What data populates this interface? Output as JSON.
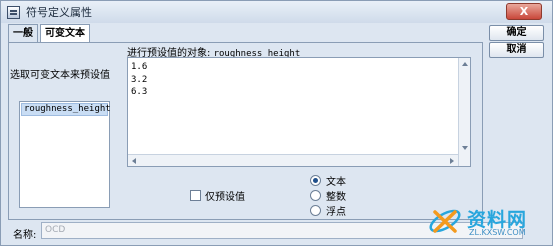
{
  "window": {
    "title": "符号定义属性",
    "close_label": "X"
  },
  "tabs": [
    {
      "label": "一般"
    },
    {
      "label": "可变文本",
      "active": true
    }
  ],
  "left": {
    "label": "选取可变文本来预设值",
    "items": [
      "roughness_height"
    ]
  },
  "right": {
    "target_prefix": "进行预设值的对象:",
    "target_name": "roughness_height",
    "values": [
      "1.6",
      "3.2",
      "6.3"
    ],
    "preset_only_label": "仅预设值",
    "types": [
      {
        "label": "文本",
        "selected": true
      },
      {
        "label": "整数",
        "selected": false
      },
      {
        "label": "浮点",
        "selected": false
      }
    ]
  },
  "buttons": {
    "ok": "确定",
    "cancel": "取消"
  },
  "name_row": {
    "label": "名称:",
    "value": "OCD"
  },
  "watermark": {
    "brand": "资料网",
    "url": "ZL.KXSW.COM"
  },
  "colors": {
    "accent": "#28a6dd",
    "selection": "#c9ddf4",
    "window_bg": "#dde6f1"
  }
}
